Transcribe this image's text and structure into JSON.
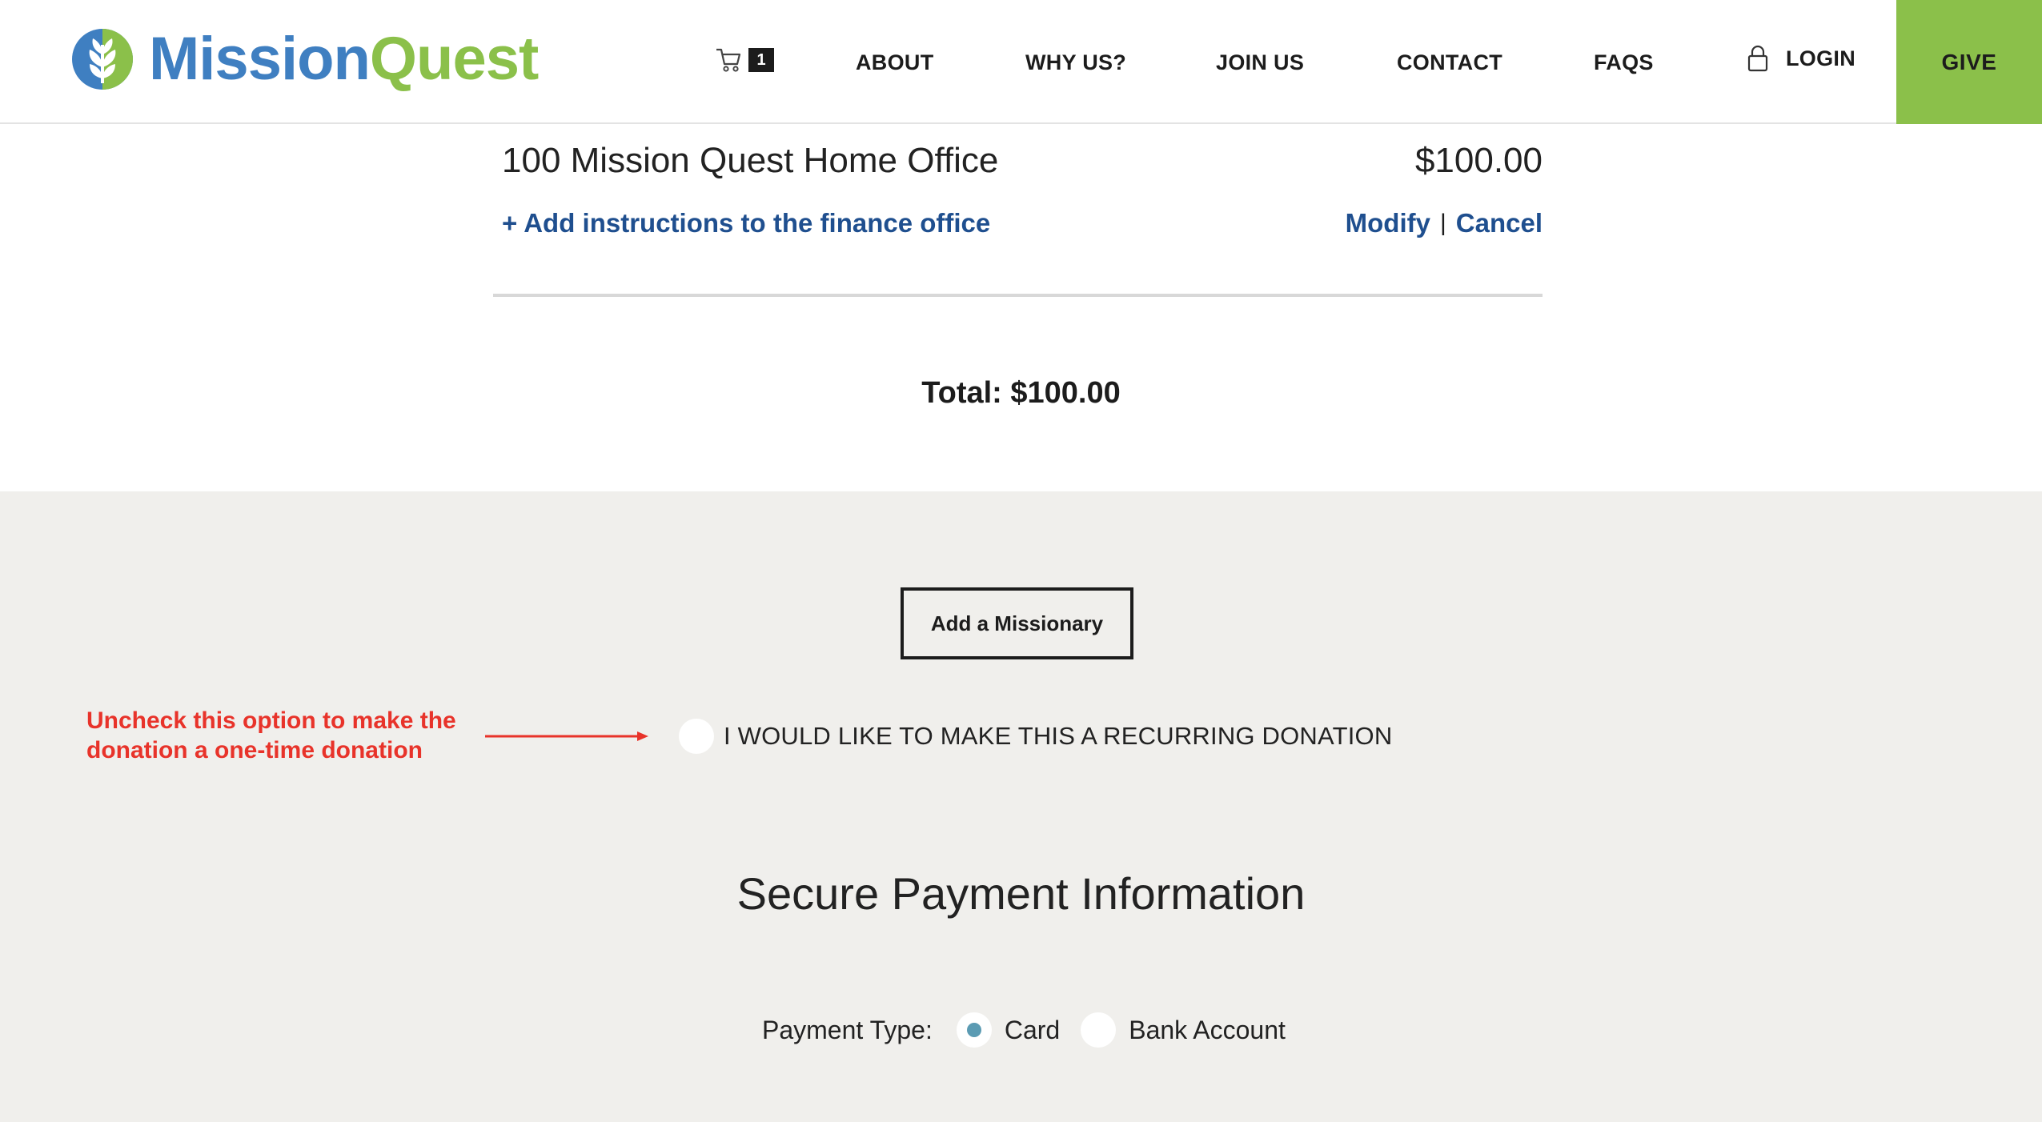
{
  "header": {
    "logo": {
      "part1": "Mission",
      "part2": "Quest"
    },
    "cart": {
      "icon": "cart-icon",
      "count": "1"
    },
    "nav": {
      "about": "ABOUT",
      "why_us": "WHY US?",
      "join_us": "JOIN US",
      "contact": "CONTACT",
      "faqs": "FAQS",
      "login": "LOGIN"
    },
    "give_label": "GIVE"
  },
  "cart_item": {
    "name": "100 Mission Quest Home Office",
    "price": "$100.00",
    "add_instructions": "+ Add instructions to the finance office",
    "modify": "Modify",
    "separator": "|",
    "cancel": "Cancel"
  },
  "total": "Total: $100.00",
  "add_missionary": "Add a Missionary",
  "annotation": {
    "line1": "Uncheck this option to make the",
    "line2": "donation a one-time donation"
  },
  "recurring": {
    "label": "I WOULD LIKE TO MAKE THIS A RECURRING DONATION",
    "checked": false
  },
  "payment": {
    "title": "Secure Payment Information",
    "type_label": "Payment Type:",
    "options": [
      {
        "label": "Card",
        "selected": true
      },
      {
        "label": "Bank Account",
        "selected": false
      }
    ]
  },
  "colors": {
    "brand_blue": "#3f7fc1",
    "brand_green": "#8bc04a",
    "link_blue": "#1f4f8f",
    "annotation_red": "#e8332a",
    "radio_selected": "#5b9bb3",
    "section_bg": "#f0efec"
  }
}
